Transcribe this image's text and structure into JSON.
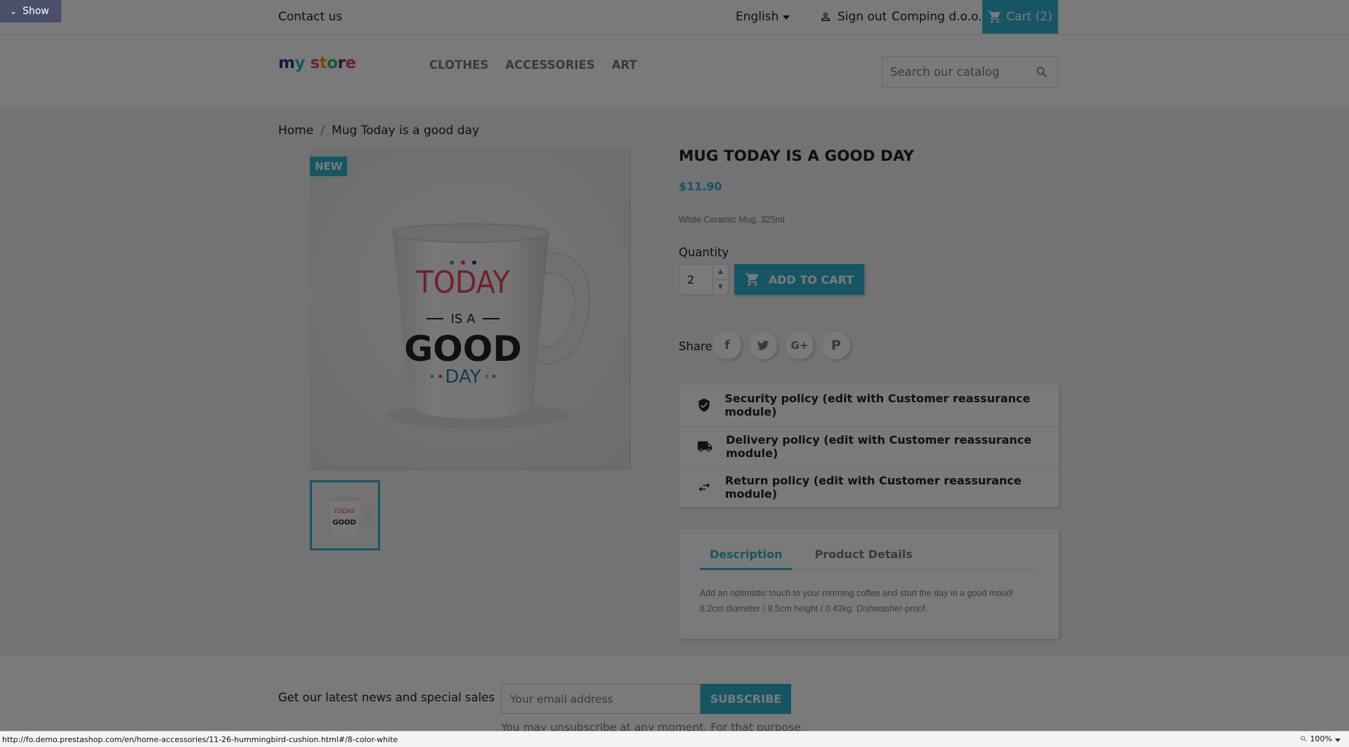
{
  "debug": {
    "show_label": "Show"
  },
  "topbar": {
    "contact": "Contact us",
    "language": "English",
    "sign_out": "Sign out",
    "company": "Comping d.o.o.",
    "cart": "Cart (2)"
  },
  "header": {
    "logo": {
      "m": "m",
      "y": "y",
      "s": "s",
      "t": "t",
      "o": "o",
      "r": "r",
      "e": "e"
    },
    "nav": [
      "CLOTHES",
      "ACCESSORIES",
      "ART"
    ],
    "search_placeholder": "Search our catalog"
  },
  "breadcrumb": {
    "home": "Home",
    "sep": "/",
    "current": "Mug Today is a good day"
  },
  "product": {
    "badge": "NEW",
    "title": "MUG TODAY IS A GOOD DAY",
    "price": "$11.90",
    "short_description": "White Ceramic Mug. 325ml",
    "quantity_label": "Quantity",
    "quantity": "2",
    "add_to_cart": "ADD TO CART",
    "mug_text": {
      "line1": "TODAY",
      "line2": "IS A",
      "line3": "GOOD",
      "line4": "DAY"
    }
  },
  "share": {
    "label": "Share",
    "networks": [
      "facebook",
      "twitter",
      "google-plus",
      "pinterest"
    ]
  },
  "reassurance": [
    {
      "icon": "shield-check-icon",
      "text": "Security policy (edit with Customer reassurance module)"
    },
    {
      "icon": "truck-icon",
      "text": "Delivery policy (edit with Customer reassurance module)"
    },
    {
      "icon": "swap-arrows-icon",
      "text": "Return policy (edit with Customer reassurance module)"
    }
  ],
  "tabs": {
    "items": [
      "Description",
      "Product Details"
    ],
    "active": "Description",
    "description_line1": "Add an optimistic touch to your morning coffee and start the day in a good mood!",
    "description_line2": "8,2cm diameter / 9,5cm height / 0.43kg. Dishwasher-proof."
  },
  "newsletter": {
    "text": "Get our latest news and special sales",
    "email_placeholder": "Your email address",
    "subscribe": "SUBSCRIBE",
    "note": "You may unsubscribe at any moment. For that purpose,"
  },
  "statusbar": {
    "url": "http://fo.demo.prestashop.com/en/home-accessories/11-26-hummingbird-cushion.html#/8-color-white",
    "zoom": "100%"
  },
  "colors": {
    "accent": "#2fb5d2",
    "debug_button": "#4a4f6a"
  }
}
